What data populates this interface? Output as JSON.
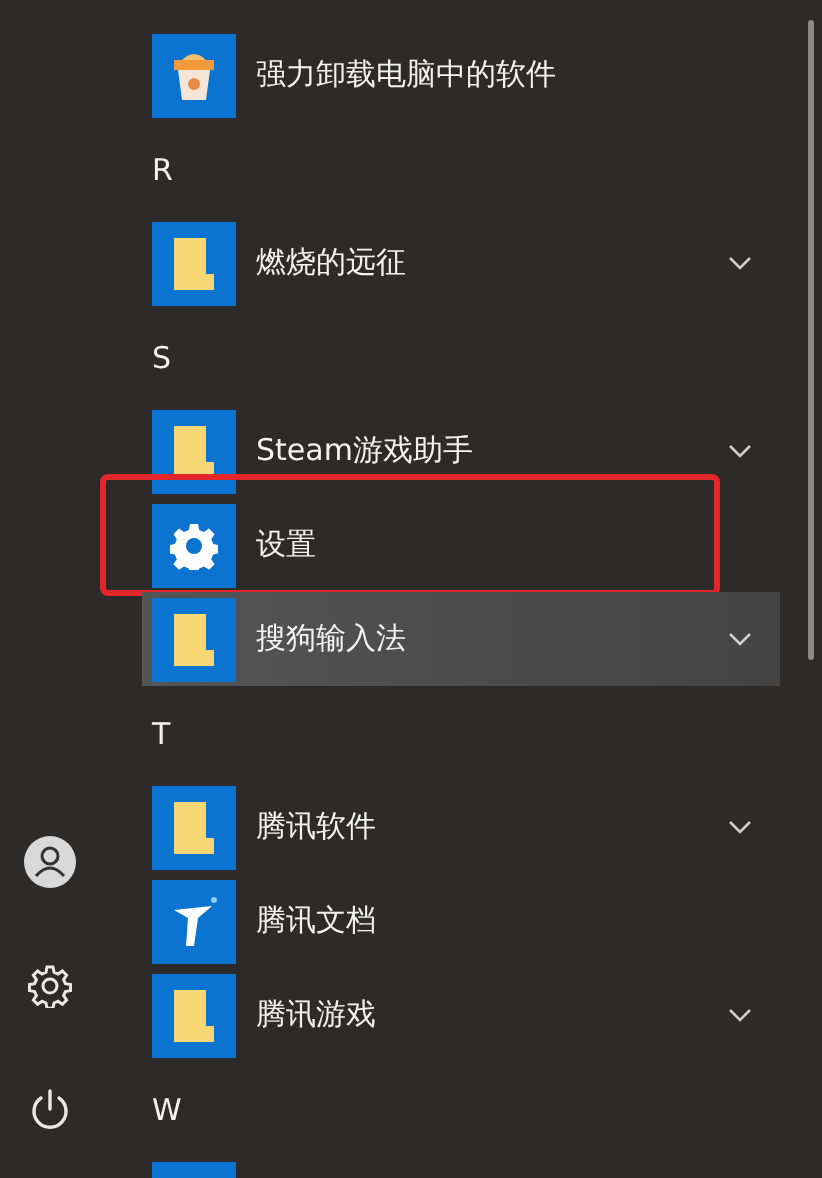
{
  "rail": [
    {
      "kind": "user"
    },
    {
      "kind": "settings"
    },
    {
      "kind": "power"
    }
  ],
  "list": [
    {
      "kind": "uninstaller",
      "name": "强力卸载电脑中的软件",
      "expandable": false,
      "hovered": false,
      "highlighted": false
    },
    {
      "kind": "header",
      "name": "R"
    },
    {
      "kind": "folder",
      "name": "燃烧的远征",
      "expandable": true,
      "hovered": false,
      "highlighted": false
    },
    {
      "kind": "header",
      "name": "S"
    },
    {
      "kind": "folder",
      "name": "Steam游戏助手",
      "expandable": true,
      "hovered": false,
      "highlighted": false
    },
    {
      "kind": "settings",
      "name": "设置",
      "expandable": false,
      "hovered": false,
      "highlighted": true
    },
    {
      "kind": "folder",
      "name": "搜狗输入法",
      "expandable": true,
      "hovered": true,
      "highlighted": false
    },
    {
      "kind": "header",
      "name": "T"
    },
    {
      "kind": "folder",
      "name": "腾讯软件",
      "expandable": true,
      "hovered": false,
      "highlighted": false
    },
    {
      "kind": "document",
      "name": "腾讯文档",
      "expandable": false,
      "hovered": false,
      "highlighted": false
    },
    {
      "kind": "folder",
      "name": "腾讯游戏",
      "expandable": true,
      "hovered": false,
      "highlighted": false
    },
    {
      "kind": "header",
      "name": "W"
    },
    {
      "kind": "tile"
    }
  ]
}
